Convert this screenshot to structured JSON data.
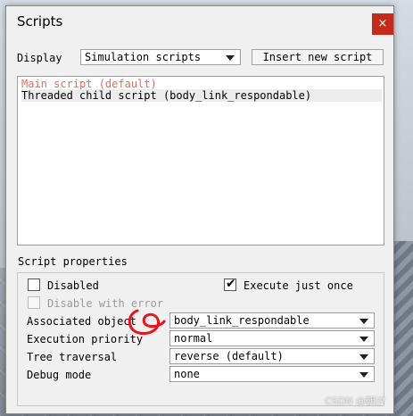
{
  "window": {
    "title": "Scripts",
    "close_glyph": "×"
  },
  "display": {
    "label": "Display",
    "selected": "Simulation scripts",
    "insert_label": "Insert new script"
  },
  "scripts": [
    {
      "label": "Main script (default)",
      "color": "#e2705c"
    },
    {
      "label": "Threaded child script (body_link_respondable)",
      "color": "#000000"
    }
  ],
  "properties": {
    "group_label": "Script properties",
    "disabled_label": "Disabled",
    "disabled_checked": false,
    "disable_with_error_label": "Disable with error",
    "execute_once_label": "Execute just once",
    "execute_once_checked": true,
    "associated_object_label": "Associated object",
    "associated_object_value": "body_link_respondable",
    "execution_priority_label": "Execution priority",
    "execution_priority_value": "normal",
    "tree_traversal_label": "Tree traversal",
    "tree_traversal_value": "reverse (default)",
    "debug_mode_label": "Debug mode",
    "debug_mode_value": "none",
    "check_glyph": "✔"
  },
  "watermark": "CSDN @朝汐",
  "colors": {
    "close_bg": "#c42b1c",
    "main_script": "#e2705c",
    "annotation": "#e8131b"
  }
}
